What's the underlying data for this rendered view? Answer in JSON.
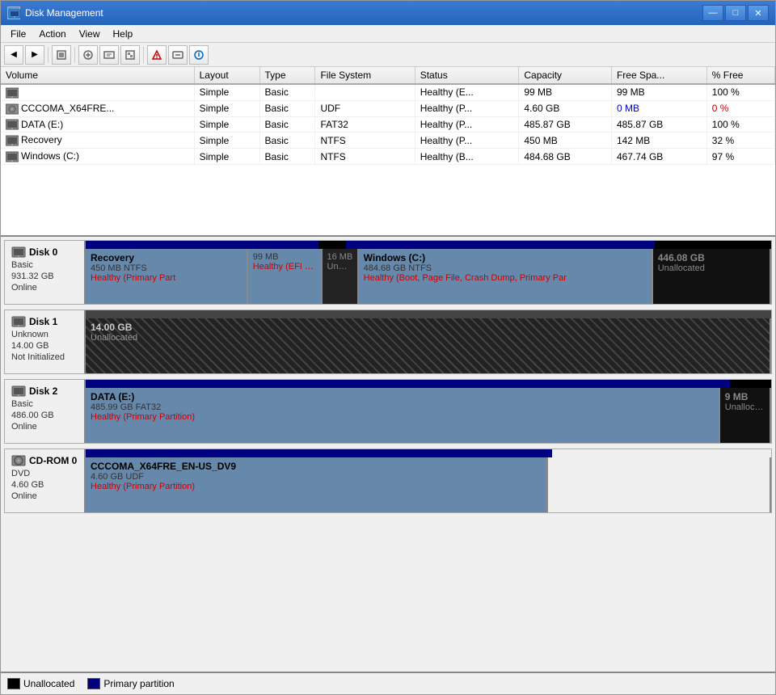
{
  "window": {
    "title": "Disk Management",
    "icon": "disk-icon"
  },
  "title_controls": {
    "minimize": "—",
    "maximize": "□",
    "close": "✕"
  },
  "menu": {
    "items": [
      "File",
      "Action",
      "View",
      "Help"
    ]
  },
  "table": {
    "columns": [
      "Volume",
      "Layout",
      "Type",
      "File System",
      "Status",
      "Capacity",
      "Free Spa...",
      "% Free"
    ],
    "rows": [
      {
        "volume": "",
        "layout": "Simple",
        "type": "Basic",
        "fs": "",
        "status": "Healthy (E...",
        "capacity": "99 MB",
        "free": "99 MB",
        "pct": "100 %",
        "icon": "disk"
      },
      {
        "volume": "CCCOMA_X64FRE...",
        "layout": "Simple",
        "type": "Basic",
        "fs": "UDF",
        "status": "Healthy (P...",
        "capacity": "4.60 GB",
        "free": "0 MB",
        "pct": "0 %",
        "icon": "cdrom"
      },
      {
        "volume": "DATA (E:)",
        "layout": "Simple",
        "type": "Basic",
        "fs": "FAT32",
        "status": "Healthy (P...",
        "capacity": "485.87 GB",
        "free": "485.87 GB",
        "pct": "100 %",
        "icon": "disk"
      },
      {
        "volume": "Recovery",
        "layout": "Simple",
        "type": "Basic",
        "fs": "NTFS",
        "status": "Healthy (P...",
        "capacity": "450 MB",
        "free": "142 MB",
        "pct": "32 %",
        "icon": "disk"
      },
      {
        "volume": "Windows (C:)",
        "layout": "Simple",
        "type": "Basic",
        "fs": "NTFS",
        "status": "Healthy (B...",
        "capacity": "484.68 GB",
        "free": "467.74 GB",
        "pct": "97 %",
        "icon": "disk"
      }
    ]
  },
  "disks": {
    "disk0": {
      "name": "Disk 0",
      "type": "Basic",
      "size": "931.32 GB",
      "status": "Online",
      "partitions": [
        {
          "name": "Recovery",
          "size": "450 MB NTFS",
          "status": "Healthy (Primary Part",
          "type": "primary",
          "flex": 24
        },
        {
          "name": "",
          "size": "99 MB",
          "status": "Healthy (EFI Sys",
          "type": "primary",
          "flex": 10
        },
        {
          "name": "",
          "size": "16 MB",
          "status": "Unalloca",
          "type": "unallocated-small",
          "flex": 4
        },
        {
          "name": "Windows (C:)",
          "size": "484.68 GB NTFS",
          "status": "Healthy (Boot, Page File, Crash Dump, Primary Par",
          "type": "primary",
          "flex": 45
        },
        {
          "name": "446.08 GB",
          "size": "",
          "status": "Unallocated",
          "type": "unallocated",
          "flex": 17
        }
      ]
    },
    "disk1": {
      "name": "Disk 1",
      "type": "Unknown",
      "size": "14.00 GB",
      "status": "Not Initialized",
      "partitions": [
        {
          "name": "14.00 GB",
          "size": "",
          "status": "Unallocated",
          "type": "unallocated-full",
          "flex": 100
        }
      ]
    },
    "disk2": {
      "name": "Disk 2",
      "type": "Basic",
      "size": "486.00 GB",
      "status": "Online",
      "partitions": [
        {
          "name": "DATA (E:)",
          "size": "485.99 GB FAT32",
          "status": "Healthy (Primary Partition)",
          "type": "primary",
          "flex": 94
        },
        {
          "name": "9 MB",
          "size": "",
          "status": "Unallocated",
          "type": "unallocated",
          "flex": 6
        }
      ]
    },
    "cdrom": {
      "name": "CD-ROM 0",
      "type": "DVD",
      "size": "4.60 GB",
      "status": "Online",
      "partitions": [
        {
          "name": "CCCOMA_X64FRE_EN-US_DV9",
          "size": "4.60 GB UDF",
          "status": "Healthy (Primary Partition)",
          "type": "cdrom",
          "flex": 68
        },
        {
          "name": "",
          "size": "",
          "status": "",
          "type": "cdrom-empty",
          "flex": 32
        }
      ]
    }
  },
  "legend": {
    "unallocated": "Unallocated",
    "primary": "Primary partition"
  },
  "status": {
    "text": ""
  }
}
